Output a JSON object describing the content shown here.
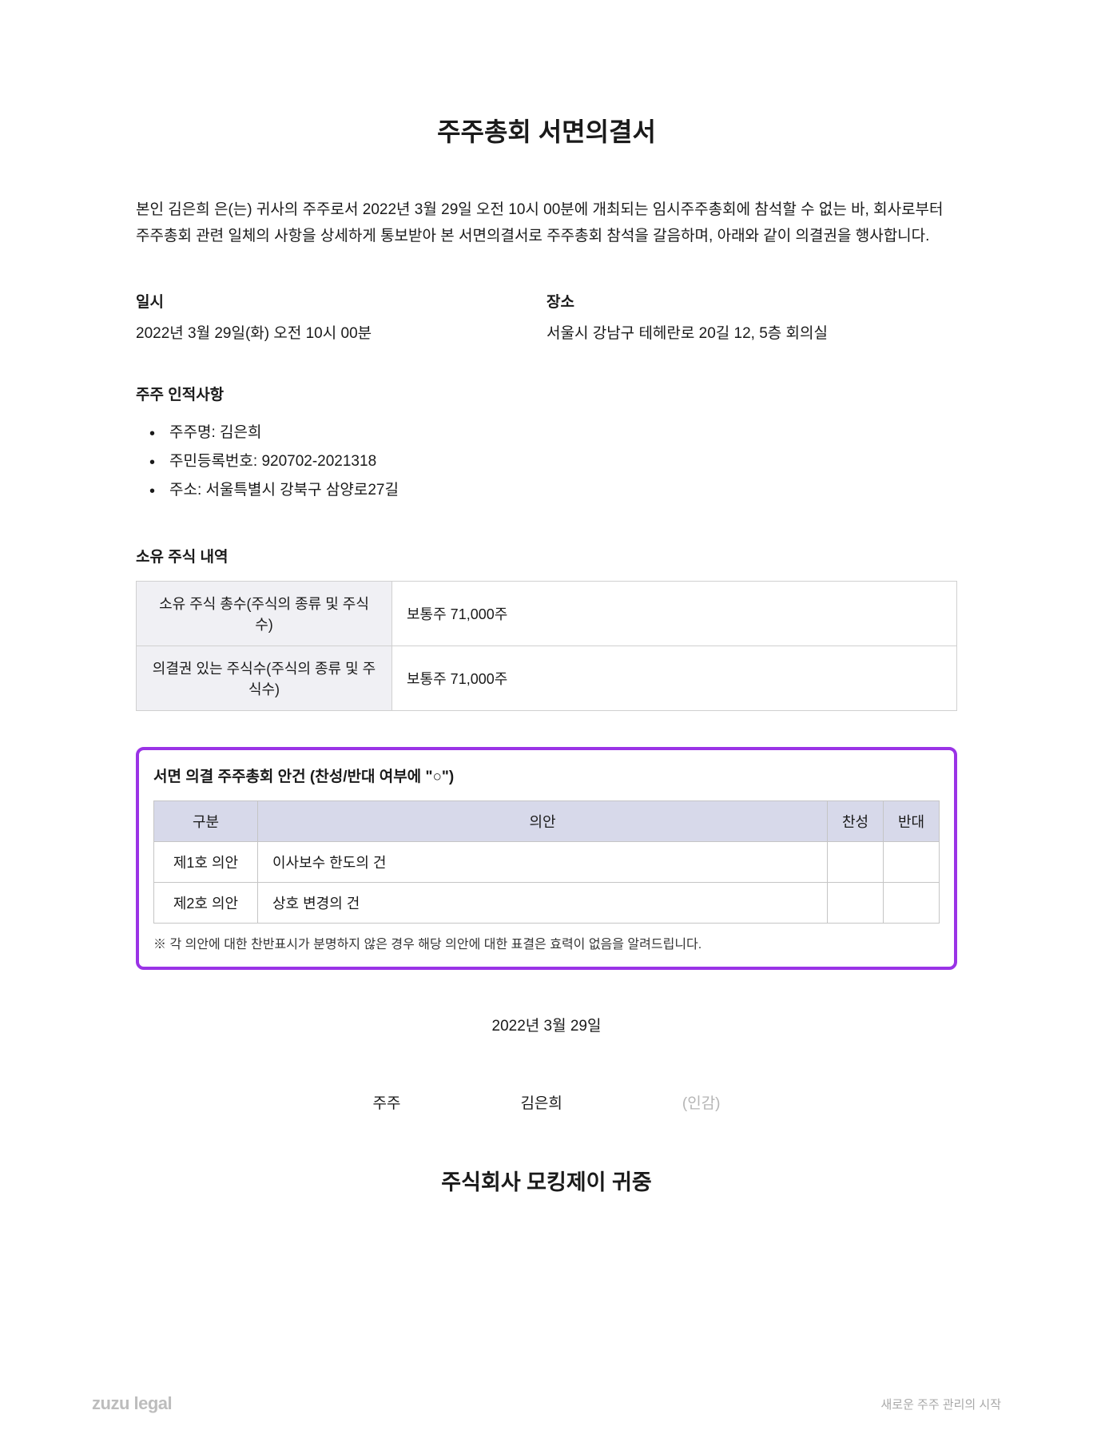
{
  "title": "주주총회 서면의결서",
  "intro": "본인 김은희 은(는) 귀사의 주주로서 2022년 3월 29일 오전 10시 00분에 개최되는 임시주주총회에 참석할 수 없는 바, 회사로부터 주주총회 관련 일체의 사항을 상세하게 통보받아 본 서면의결서로 주주총회 참석을 갈음하며, 아래와 같이 의결권을 행사합니다.",
  "datetime": {
    "label": "일시",
    "value": "2022년 3월 29일(화) 오전 10시 00분"
  },
  "location": {
    "label": "장소",
    "value": "서울시 강남구 테헤란로 20길 12, 5층 회의실"
  },
  "shareholder_section": "주주 인적사항",
  "shareholder": {
    "name_label": "주주명: 김은희",
    "id_label": "주민등록번호: 920702-2021318",
    "address_label": "주소: 서울특별시 강북구 삼양로27길"
  },
  "shares_section": "소유 주식 내역",
  "shares": {
    "row1_label": "소유 주식 총수(주식의 종류 및 주식수)",
    "row1_value": "보통주 71,000주",
    "row2_label": "의결권 있는 주식수(주식의 종류 및 주식수)",
    "row2_value": "보통주 71,000주"
  },
  "agenda_section": "서면 의결 주주총회 안건 (찬성/반대 여부에 \"○\")",
  "agenda_headers": {
    "num": "구분",
    "item": "의안",
    "yes": "찬성",
    "no": "반대"
  },
  "agenda_rows": [
    {
      "num": "제1호 의안",
      "item": "이사보수 한도의 건"
    },
    {
      "num": "제2호 의안",
      "item": "상호 변경의 건"
    }
  ],
  "agenda_note": "※ 각 의안에 대한 찬반표시가 분명하지 않은 경우 해당 의안에 대한 표결은 효력이 없음을 알려드립니다.",
  "sign_date": "2022년 3월 29일",
  "sign": {
    "role": "주주",
    "name": "김은희",
    "seal": "(인감)"
  },
  "recipient": "주식회사 모킹제이 귀중",
  "footer": {
    "logo": "zuzu legal",
    "tagline": "새로운 주주 관리의 시작"
  }
}
